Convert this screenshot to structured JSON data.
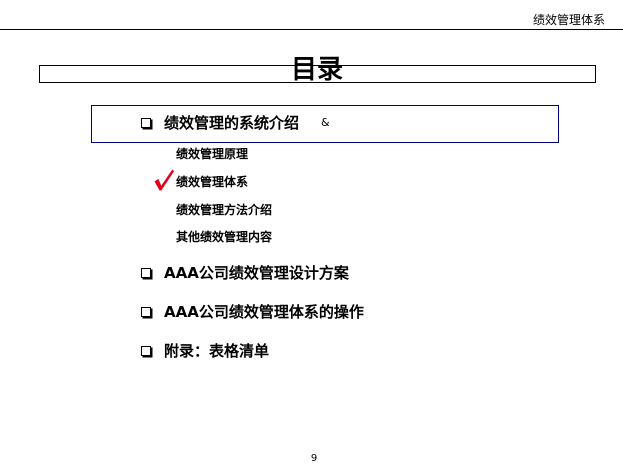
{
  "header": {
    "title": "绩效管理体系"
  },
  "page": {
    "title": "目录",
    "number": "9"
  },
  "toc": {
    "items": [
      {
        "label": "绩效管理的系统介绍",
        "marker": "&",
        "subitems": [
          "绩效管理原理",
          "绩效管理体系",
          "绩效管理方法介绍",
          "其他绩效管理内容"
        ]
      },
      {
        "label": "AAA公司绩效管理设计方案"
      },
      {
        "label": "AAA公司绩效管理体系的操作"
      },
      {
        "label": "附录：表格清单"
      }
    ]
  },
  "icons": {
    "bullet": "hollow-square-bullet-icon",
    "current": "red-checkmark-icon"
  },
  "colors": {
    "text": "#000000",
    "highlight_border": "#000080",
    "checkmark": "#e0001b"
  }
}
